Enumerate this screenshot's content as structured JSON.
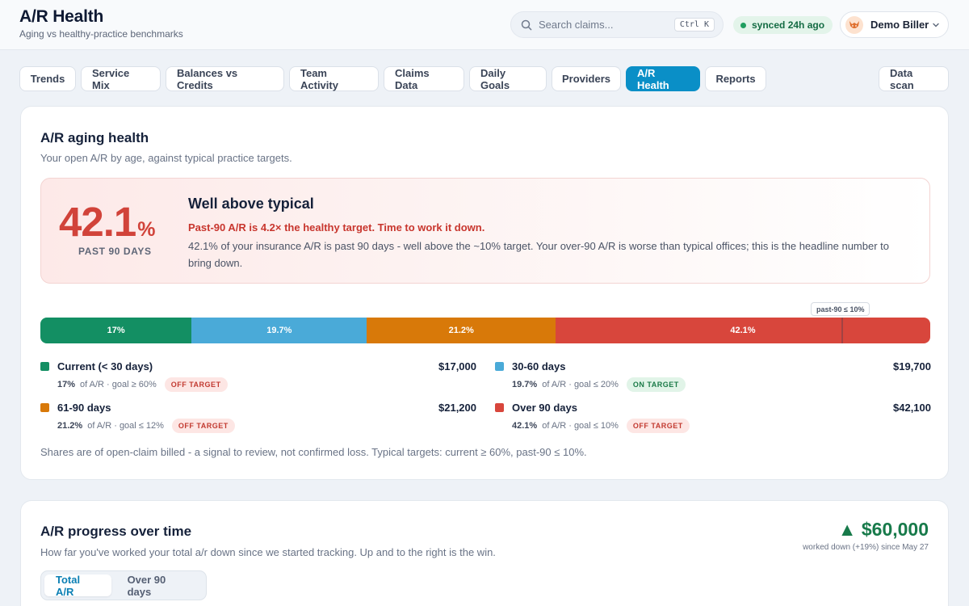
{
  "header": {
    "title": "A/R Health",
    "subtitle": "Aging vs healthy-practice benchmarks",
    "search_placeholder": "Search claims...",
    "search_shortcut": "Ctrl K",
    "sync_status": "synced 24h ago",
    "user_name": "Demo Biller"
  },
  "tabs": [
    {
      "label": "Trends"
    },
    {
      "label": "Service Mix"
    },
    {
      "label": "Balances vs Credits"
    },
    {
      "label": "Team Activity"
    },
    {
      "label": "Claims Data"
    },
    {
      "label": "Daily Goals"
    },
    {
      "label": "Providers"
    },
    {
      "label": "A/R Health",
      "active": true
    },
    {
      "label": "Reports"
    }
  ],
  "data_scan_label": "Data scan",
  "aging": {
    "title": "A/R aging health",
    "subtitle": "Your open A/R by age, against typical practice targets.",
    "headline_value": "42.1",
    "headline_unit": "%",
    "headline_label": "PAST 90 DAYS",
    "verdict": "Well above typical",
    "verdict_sub": "Past-90 A/R is 4.2× the healthy target. Time to work it down.",
    "verdict_body": "42.1% of your insurance A/R is past 90 days - well above the ~10% target. Your over-90 A/R is worse than typical offices; this is the headline number to bring down.",
    "target_marker": "past-90 ≤ 10%",
    "segments": [
      {
        "label": "17%",
        "share": 17.0,
        "color": "#138f63"
      },
      {
        "label": "19.7%",
        "share": 19.7,
        "color": "#4aaad8"
      },
      {
        "label": "21.2%",
        "share": 21.2,
        "color": "#d87909"
      },
      {
        "label": "42.1%",
        "share": 42.1,
        "color": "#d8463c"
      }
    ],
    "buckets": [
      {
        "name": "Current (< 30 days)",
        "amount": "$17,000",
        "pct": "17%",
        "goal": "of A/R · goal ≥ 60%",
        "status": "OFF TARGET",
        "color": "#138f63"
      },
      {
        "name": "30-60 days",
        "amount": "$19,700",
        "pct": "19.7%",
        "goal": "of A/R · goal ≤ 20%",
        "status": "ON TARGET",
        "color": "#4aaad8"
      },
      {
        "name": "61-90 days",
        "amount": "$21,200",
        "pct": "21.2%",
        "goal": "of A/R · goal ≤ 12%",
        "status": "OFF TARGET",
        "color": "#d87909"
      },
      {
        "name": "Over 90 days",
        "amount": "$42,100",
        "pct": "42.1%",
        "goal": "of A/R · goal ≤ 10%",
        "status": "OFF TARGET",
        "color": "#d8463c"
      }
    ],
    "footnote": "Shares are of open-claim billed - a signal to review, not confirmed loss. Typical targets: current ≥ 60%, past-90 ≤ 10%."
  },
  "progress": {
    "title": "A/R progress over time",
    "subtitle": "How far you've worked your total a/r down since we started tracking. Up and to the right is the win.",
    "worked_amount": "▲ $60,000",
    "worked_note": "worked down (+19%) since May 27",
    "toggle": [
      {
        "label": "Total A/R",
        "active": true
      },
      {
        "label": "Over 90 days",
        "active": false
      }
    ]
  },
  "colors": {
    "accent": "#0a8fc7",
    "danger": "#d1433a",
    "success": "#177a4a"
  }
}
